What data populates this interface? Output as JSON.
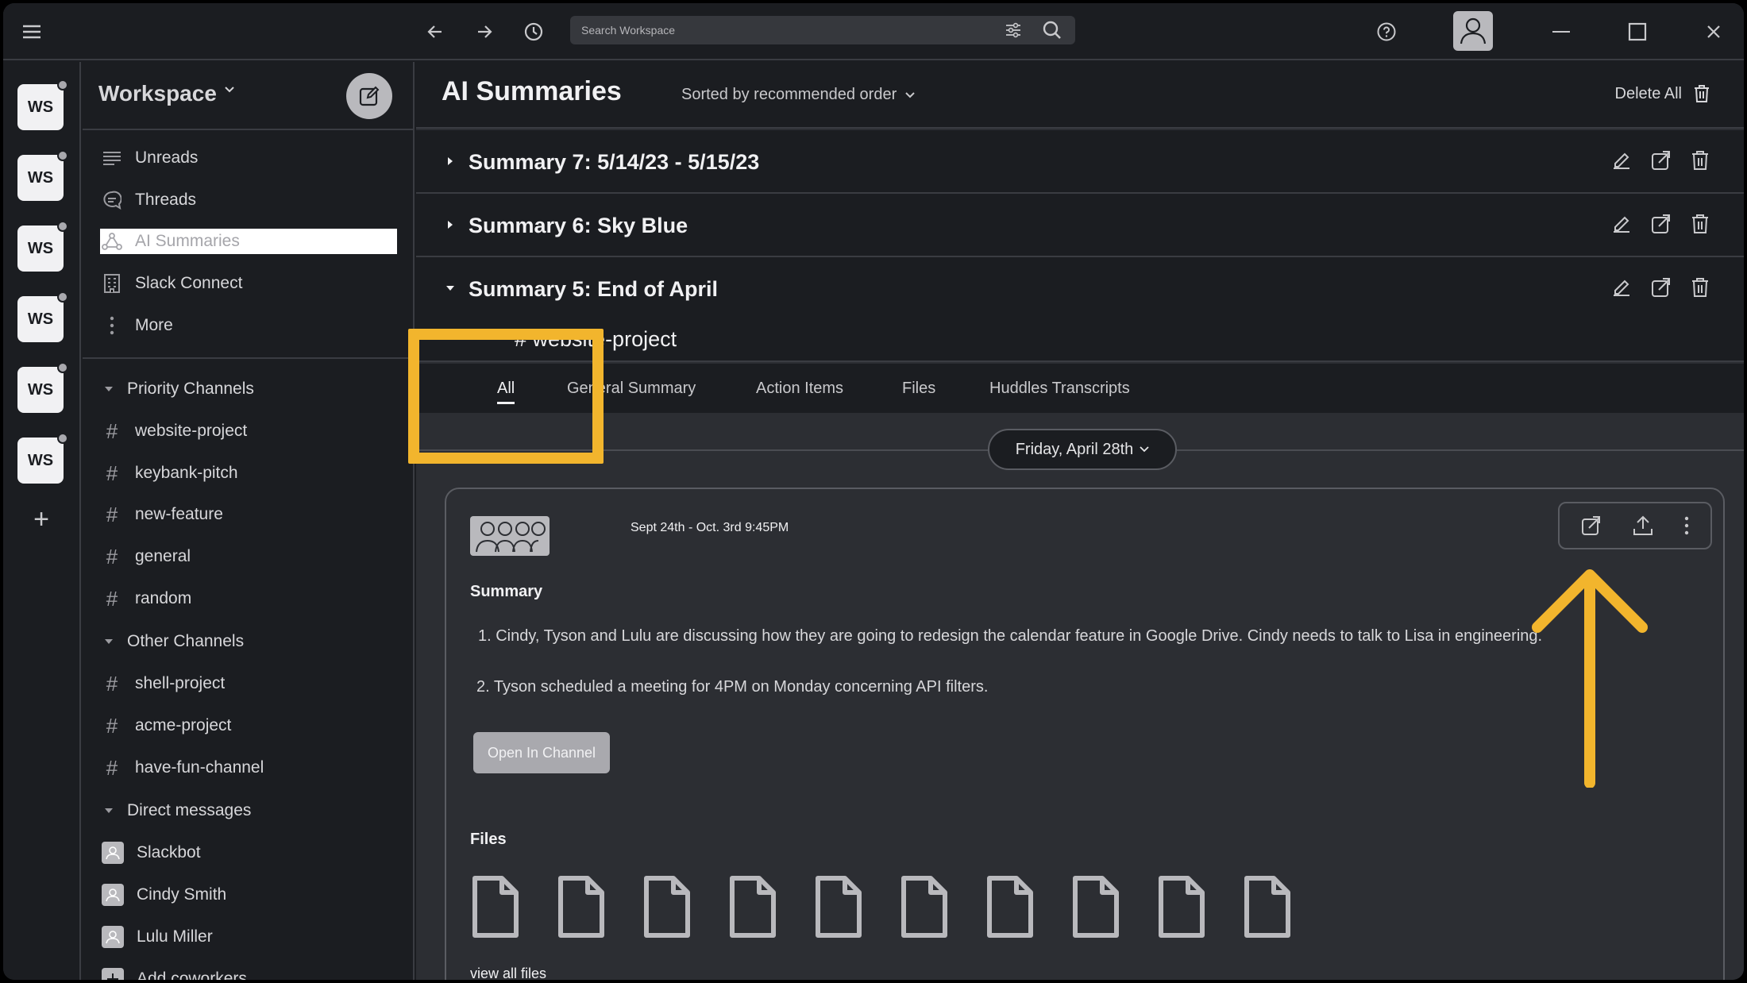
{
  "topbar": {
    "search_placeholder": "Search Workspace",
    "icons": [
      "hamburger-icon",
      "arrow-left-icon",
      "arrow-right-icon",
      "history-icon",
      "filter-icon",
      "search-icon",
      "help-icon",
      "user-icon",
      "minimize-icon",
      "maximize-icon",
      "close-icon"
    ]
  },
  "rail": {
    "workspaces": [
      "WS",
      "WS",
      "WS",
      "WS",
      "WS",
      "WS"
    ],
    "add_label": "+"
  },
  "sidebar": {
    "workspace_name": "Workspace",
    "nav": [
      {
        "label": "Unreads",
        "icon": "unreads-icon"
      },
      {
        "label": "Threads",
        "icon": "threads-icon"
      },
      {
        "label": "AI Summaries",
        "icon": "ai-summaries-icon",
        "active": true
      },
      {
        "label": "Slack Connect",
        "icon": "building-icon"
      },
      {
        "label": "More",
        "icon": "more-vertical-icon"
      }
    ],
    "priority_channels_label": "Priority Channels",
    "priority_channels": [
      "website-project",
      "keybank-pitch",
      "new-feature",
      "general",
      "random"
    ],
    "other_channels_label": "Other Channels",
    "other_channels": [
      "shell-project",
      "acme-project",
      "have-fun-channel"
    ],
    "direct_messages_label": "Direct messages",
    "direct_messages": [
      "Slackbot",
      "Cindy Smith",
      "Lulu Miller"
    ],
    "add_coworkers": "Add coworkers"
  },
  "main": {
    "title": "AI Summaries",
    "sort_label": "Sorted by recommended order",
    "delete_all": "Delete All",
    "summaries": [
      {
        "title": "Summary 7: 5/14/23 - 5/15/23",
        "expanded": false
      },
      {
        "title": "Summary 6: Sky Blue",
        "expanded": false
      },
      {
        "title": "Summary 5: End of April",
        "expanded": true
      }
    ],
    "channel": "# website-project",
    "tabs": [
      "All",
      "General Summary",
      "Action Items",
      "Files",
      "Huddles Transcripts"
    ],
    "active_tab": "All",
    "date_filter": "Friday, April 28th",
    "card": {
      "date_range": "Sept 24th - Oct. 3rd 9:45PM",
      "summary_heading": "Summary",
      "summary_items": [
        "1. Cindy, Tyson and Lulu are discussing how they are going to redesign the calendar feature in Google Drive. Cindy needs to talk to Lisa in engineering.",
        "2. Tyson scheduled a meeting for 4PM on Monday concerning API filters."
      ],
      "open_button": "Open In Channel",
      "files_heading": "Files",
      "file_count": 10,
      "view_all": "view all files"
    }
  },
  "colors": {
    "background": "#1b1d21",
    "panel": "#2c2e33",
    "highlight": "#f2b52d",
    "divider": "#3a3c42"
  }
}
